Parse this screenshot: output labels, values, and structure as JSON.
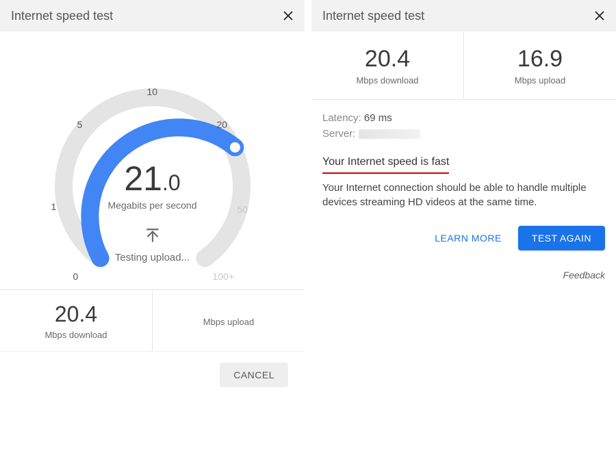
{
  "left": {
    "title": "Internet speed test",
    "gauge": {
      "digits": "21",
      "decimal": ".0",
      "unit": "Megabits per second",
      "status": "Testing upload...",
      "ticks": {
        "t0": "0",
        "t1": "1",
        "t5": "5",
        "t10": "10",
        "t20": "20",
        "t50": "50",
        "t100": "100+"
      }
    },
    "download": {
      "value": "20.4",
      "label": "Mbps download"
    },
    "upload": {
      "value": "",
      "label": "Mbps upload"
    },
    "cancel": "CANCEL"
  },
  "right": {
    "title": "Internet speed test",
    "download": {
      "value": "20.4",
      "label": "Mbps download"
    },
    "upload": {
      "value": "16.9",
      "label": "Mbps upload"
    },
    "latency_label": "Latency:",
    "latency_value": "69 ms",
    "server_label": "Server:",
    "headline": "Your Internet speed is fast",
    "message": "Your Internet connection should be able to handle multiple devices streaming HD videos at the same time.",
    "learn_more": "LEARN MORE",
    "test_again": "TEST AGAIN",
    "feedback": "Feedback"
  },
  "chart_data": {
    "type": "other",
    "title": "Internet speed test — live gauge",
    "unit": "Megabits per second",
    "scale_ticks": [
      0,
      1,
      5,
      10,
      20,
      50,
      100
    ],
    "current_value": 21.0,
    "download_mbps": 20.4,
    "upload_mbps": 16.9,
    "latency_ms": 69
  }
}
